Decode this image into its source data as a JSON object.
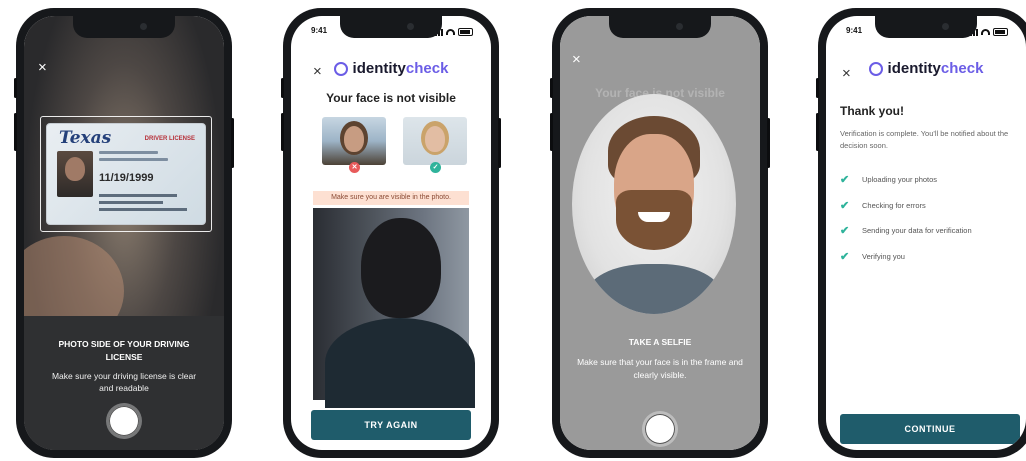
{
  "brand": {
    "name_plain": "identity",
    "name_accent": "check",
    "accent": "#6b5de6",
    "button_color": "#1f5c6b",
    "success_color": "#2fb39b",
    "error_color": "#e85a5a"
  },
  "status_bar": {
    "time": "9:41"
  },
  "close_icon_glyph": "×",
  "phone1": {
    "card": {
      "state": "Texas",
      "type": "DRIVER LICENSE",
      "date": "11/19/1999"
    },
    "title": "PHOTO SIDE OF YOUR DRIVING LICENSE",
    "hint": "Make sure your driving license is clear and readable"
  },
  "phone2": {
    "heading": "Your face is not visible",
    "badge_bad": "✕",
    "badge_good": "✓",
    "warning": "Make sure you are visible in the photo.",
    "button": "TRY AGAIN"
  },
  "phone3": {
    "ghost_heading": "Your face is not visible",
    "title": "TAKE A SELFIE",
    "hint": "Make sure that your face is in the frame and clearly visible."
  },
  "phone4": {
    "heading": "Thank you!",
    "message": "Verification is complete. You'll be notified about the decision soon.",
    "check_glyph": "✔",
    "steps": [
      "Uploading your photos",
      "Checking for errors",
      "Sending your data for verification",
      "Verifying you"
    ],
    "button": "CONTINUE"
  }
}
